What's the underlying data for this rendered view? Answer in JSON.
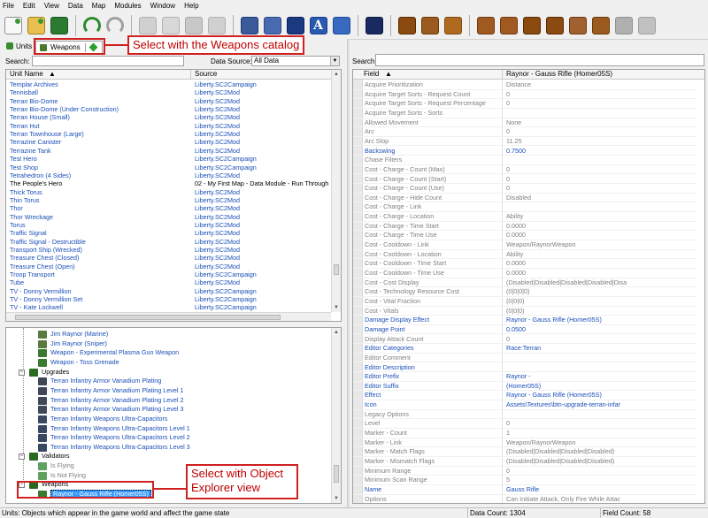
{
  "menu": [
    "File",
    "Edit",
    "View",
    "Data",
    "Map",
    "Modules",
    "Window",
    "Help"
  ],
  "left": {
    "tab_prefix": "Units",
    "weapons_tab": "Weapons",
    "callout_weapons": "Select with the Weapons catalog",
    "search_label": "Search:",
    "data_source_label": "Data Source:",
    "data_source_value": "All Data",
    "col_name": "Unit Name",
    "col_source": "Source",
    "units": [
      {
        "name": "Templar Archives",
        "source": "Liberty.SC2Campaign",
        "color": "blue"
      },
      {
        "name": "Tennisball",
        "source": "Liberty.SC2Mod",
        "color": "blue"
      },
      {
        "name": "Terran Bio-Dome",
        "source": "Liberty.SC2Mod",
        "color": "blue"
      },
      {
        "name": "Terran Bio-Dome (Under Construction)",
        "source": "Liberty.SC2Mod",
        "color": "blue"
      },
      {
        "name": "Terran House (Small)",
        "source": "Liberty.SC2Mod",
        "color": "blue"
      },
      {
        "name": "Terran Hut",
        "source": "Liberty.SC2Mod",
        "color": "blue"
      },
      {
        "name": "Terran Townhouse (Large)",
        "source": "Liberty.SC2Mod",
        "color": "blue"
      },
      {
        "name": "Terrazine Canister",
        "source": "Liberty.SC2Mod",
        "color": "blue"
      },
      {
        "name": "Terrazine Tank",
        "source": "Liberty.SC2Mod",
        "color": "blue"
      },
      {
        "name": "Test Hero",
        "source": "Liberty.SC2Campaign",
        "color": "blue"
      },
      {
        "name": "Test Shop",
        "source": "Liberty.SC2Campaign",
        "color": "blue"
      },
      {
        "name": "Tetrahedron (4 Sides)",
        "source": "Liberty.SC2Mod",
        "color": "blue"
      },
      {
        "name": "The People's Hero",
        "source": "02 - My First Map - Data Module - Run Through E",
        "color": "black"
      },
      {
        "name": "Thick Torus",
        "source": "Liberty.SC2Mod",
        "color": "blue"
      },
      {
        "name": "Thin Torus",
        "source": "Liberty.SC2Mod",
        "color": "blue"
      },
      {
        "name": "Thor",
        "source": "Liberty.SC2Mod",
        "color": "blue"
      },
      {
        "name": "Thor Wreckage",
        "source": "Liberty.SC2Mod",
        "color": "blue"
      },
      {
        "name": "Torus",
        "source": "Liberty.SC2Mod",
        "color": "blue"
      },
      {
        "name": "Traffic Signal",
        "source": "Liberty.SC2Mod",
        "color": "blue"
      },
      {
        "name": "Traffic Signal - Destructible",
        "source": "Liberty.SC2Mod",
        "color": "blue"
      },
      {
        "name": "Transport Ship (Wrecked)",
        "source": "Liberty.SC2Mod",
        "color": "blue"
      },
      {
        "name": "Treasure Chest (Closed)",
        "source": "Liberty.SC2Mod",
        "color": "blue"
      },
      {
        "name": "Treasure Chest (Open)",
        "source": "Liberty.SC2Mod",
        "color": "blue"
      },
      {
        "name": "Troop Transport",
        "source": "Liberty.SC2Campaign",
        "color": "blue"
      },
      {
        "name": "Tube",
        "source": "Liberty.SC2Mod",
        "color": "blue"
      },
      {
        "name": "TV - Donny Vermillion",
        "source": "Liberty.SC2Campaign",
        "color": "blue"
      },
      {
        "name": "TV - Donny Vermillion Set",
        "source": "Liberty.SC2Campaign",
        "color": "blue"
      },
      {
        "name": "TV - Kate Lockwell",
        "source": "Liberty.SC2Campaign",
        "color": "blue"
      }
    ],
    "tree": [
      {
        "label": "Jim Raynor (Marine)",
        "indent": 3,
        "icon": "#5a7a40",
        "color": "blue"
      },
      {
        "label": "Jim Raynor (Sniper)",
        "indent": 3,
        "icon": "#5a7a40",
        "color": "blue"
      },
      {
        "label": "Weapon - Experimental Plasma Gun Weapon",
        "indent": 3,
        "icon": "#3a7a30",
        "color": "blue"
      },
      {
        "label": "Weapon - Toss Grenade",
        "indent": 3,
        "icon": "#3a7a30",
        "color": "blue"
      },
      {
        "label": "Upgrades",
        "indent": 1,
        "icon": "#2a6a20",
        "color": "black",
        "expand": "−"
      },
      {
        "label": "Terran Infantry Armor Vanadium Plating",
        "indent": 3,
        "icon": "#404858",
        "color": "blue"
      },
      {
        "label": "Terran Infantry Armor Vanadium Plating Level 1",
        "indent": 3,
        "icon": "#404858",
        "color": "blue"
      },
      {
        "label": "Terran Infantry Armor Vanadium Plating Level 2",
        "indent": 3,
        "icon": "#404858",
        "color": "blue"
      },
      {
        "label": "Terran Infantry Armor Vanadium Plating Level 3",
        "indent": 3,
        "icon": "#404858",
        "color": "blue"
      },
      {
        "label": "Terran Infantry Weapons Ultra-Capacitors",
        "indent": 3,
        "icon": "#384860",
        "color": "blue"
      },
      {
        "label": "Terran Infantry Weapons Ultra-Capacitors Level 1",
        "indent": 3,
        "icon": "#384860",
        "color": "blue"
      },
      {
        "label": "Terran Infantry Weapons Ultra-Capacitors Level 2",
        "indent": 3,
        "icon": "#384860",
        "color": "blue"
      },
      {
        "label": "Terran Infantry Weapons Ultra-Capacitors Level 3",
        "indent": 3,
        "icon": "#384860",
        "color": "blue"
      },
      {
        "label": "Validators",
        "indent": 1,
        "icon": "#2a6a20",
        "color": "black",
        "expand": "−"
      },
      {
        "label": "Is Flying",
        "indent": 3,
        "icon": "#60a060",
        "color": "gray"
      },
      {
        "label": "Is Not Flying",
        "indent": 3,
        "icon": "#60a060",
        "color": "gray"
      },
      {
        "label": "Weapons",
        "indent": 1,
        "icon": "#2a6a20",
        "color": "black",
        "expand": "−"
      },
      {
        "label": "Raynor - Gauss Rifle (Homer05S)",
        "indent": 3,
        "icon": "#3a7a30",
        "color": "selected"
      }
    ],
    "callout_explorer": "Select with Object Explorer view"
  },
  "right": {
    "search_label": "Search:",
    "col_field": "Field",
    "col_value": "Raynor - Gauss Rifle (Homer05S)",
    "fields": [
      {
        "f": "Acquire Prioritization",
        "v": "Distance",
        "c": "gray"
      },
      {
        "f": "Acquire Target Sorts - Request Count",
        "v": "0",
        "c": "gray"
      },
      {
        "f": "Acquire Target Sorts - Request Percentage",
        "v": "0",
        "c": "gray"
      },
      {
        "f": "Acquire Target Sorts - Sorts",
        "v": "",
        "c": "gray"
      },
      {
        "f": "Allowed Movement",
        "v": "None",
        "c": "gray"
      },
      {
        "f": "Arc",
        "v": "0",
        "c": "gray"
      },
      {
        "f": "Arc Slop",
        "v": "11.25",
        "c": "gray"
      },
      {
        "f": "Backswing",
        "v": "0.7500",
        "c": "blue"
      },
      {
        "f": "Chase Filters",
        "v": "",
        "c": "gray"
      },
      {
        "f": "Cost - Charge - Count (Max)",
        "v": "0",
        "c": "gray"
      },
      {
        "f": "Cost - Charge - Count (Start)",
        "v": "0",
        "c": "gray"
      },
      {
        "f": "Cost - Charge - Count (Use)",
        "v": "0",
        "c": "gray"
      },
      {
        "f": "Cost - Charge - Hide Count",
        "v": "Disabled",
        "c": "gray"
      },
      {
        "f": "Cost - Charge - Link",
        "v": "",
        "c": "gray"
      },
      {
        "f": "Cost - Charge - Location",
        "v": "Ability",
        "c": "gray"
      },
      {
        "f": "Cost - Charge - Time Start",
        "v": "0.0000",
        "c": "gray"
      },
      {
        "f": "Cost - Charge - Time Use",
        "v": "0.0000",
        "c": "gray"
      },
      {
        "f": "Cost - Cooldown - Link",
        "v": "Weapon/RaynorWeapon",
        "c": "gray"
      },
      {
        "f": "Cost - Cooldown - Location",
        "v": "Ability",
        "c": "gray"
      },
      {
        "f": "Cost - Cooldown - Time Start",
        "v": "0.0000",
        "c": "gray"
      },
      {
        "f": "Cost - Cooldown - Time Use",
        "v": "0.0000",
        "c": "gray"
      },
      {
        "f": "Cost - Cost Display",
        "v": "(Disabled|Disabled|Disabled|Disabled|Disa",
        "c": "gray"
      },
      {
        "f": "Cost - Technology Resource Cost",
        "v": "(0|0|0|0)",
        "c": "gray"
      },
      {
        "f": "Cost - Vital Fraction",
        "v": "(0|0|0)",
        "c": "gray"
      },
      {
        "f": "Cost - Vitals",
        "v": "(0|0|0)",
        "c": "gray"
      },
      {
        "f": "Damage Display Effect",
        "v": "Raynor - Gauss Rifle (Homer05S)",
        "c": "blue"
      },
      {
        "f": "Damage Point",
        "v": "0.0500",
        "c": "blue"
      },
      {
        "f": "Display Attack Count",
        "v": "0",
        "c": "gray"
      },
      {
        "f": "Editor Categories",
        "v": "Race:Terran",
        "c": "blue"
      },
      {
        "f": "Editor Comment",
        "v": "",
        "c": "gray"
      },
      {
        "f": "Editor Description",
        "v": "",
        "c": "blue"
      },
      {
        "f": "Editor Prefix",
        "v": "Raynor -",
        "c": "blue"
      },
      {
        "f": "Editor Suffix",
        "v": "(Homer05S)",
        "c": "blue"
      },
      {
        "f": "Effect",
        "v": "Raynor - Gauss Rifle (Homer05S)",
        "c": "blue"
      },
      {
        "f": "Icon",
        "v": "Assets\\Textures\\btn-upgrade-terran-infar",
        "c": "blue"
      },
      {
        "f": "Legacy Options",
        "v": "",
        "c": "gray"
      },
      {
        "f": "Level",
        "v": "0",
        "c": "gray"
      },
      {
        "f": "Marker - Count",
        "v": "1",
        "c": "gray"
      },
      {
        "f": "Marker - Link",
        "v": "Weapon/RaynorWeapon",
        "c": "gray"
      },
      {
        "f": "Marker - Match Flags",
        "v": "(Disabled|Disabled|Disabled|Disabled)",
        "c": "gray"
      },
      {
        "f": "Marker - Mismatch Flags",
        "v": "(Disabled|Disabled|Disabled|Disabled)",
        "c": "gray"
      },
      {
        "f": "Minimum Range",
        "v": "0",
        "c": "gray"
      },
      {
        "f": "Minimum Scan Range",
        "v": "5",
        "c": "gray"
      },
      {
        "f": "Name",
        "v": "Gauss Rifle",
        "c": "blue"
      },
      {
        "f": "Options",
        "v": "Can Initiate Attack, Only Fire While Attac",
        "c": "gray"
      }
    ]
  },
  "status": {
    "message": "Units: Objects which appear in the game world and affect the game state",
    "data_count": "Data Count: 1304",
    "field_count": "Field Count: 58"
  },
  "colors": {
    "callout_red": "#d02020",
    "link_blue": "#1a4fb8",
    "field_gray": "#808080",
    "selection": "#3399ff"
  }
}
